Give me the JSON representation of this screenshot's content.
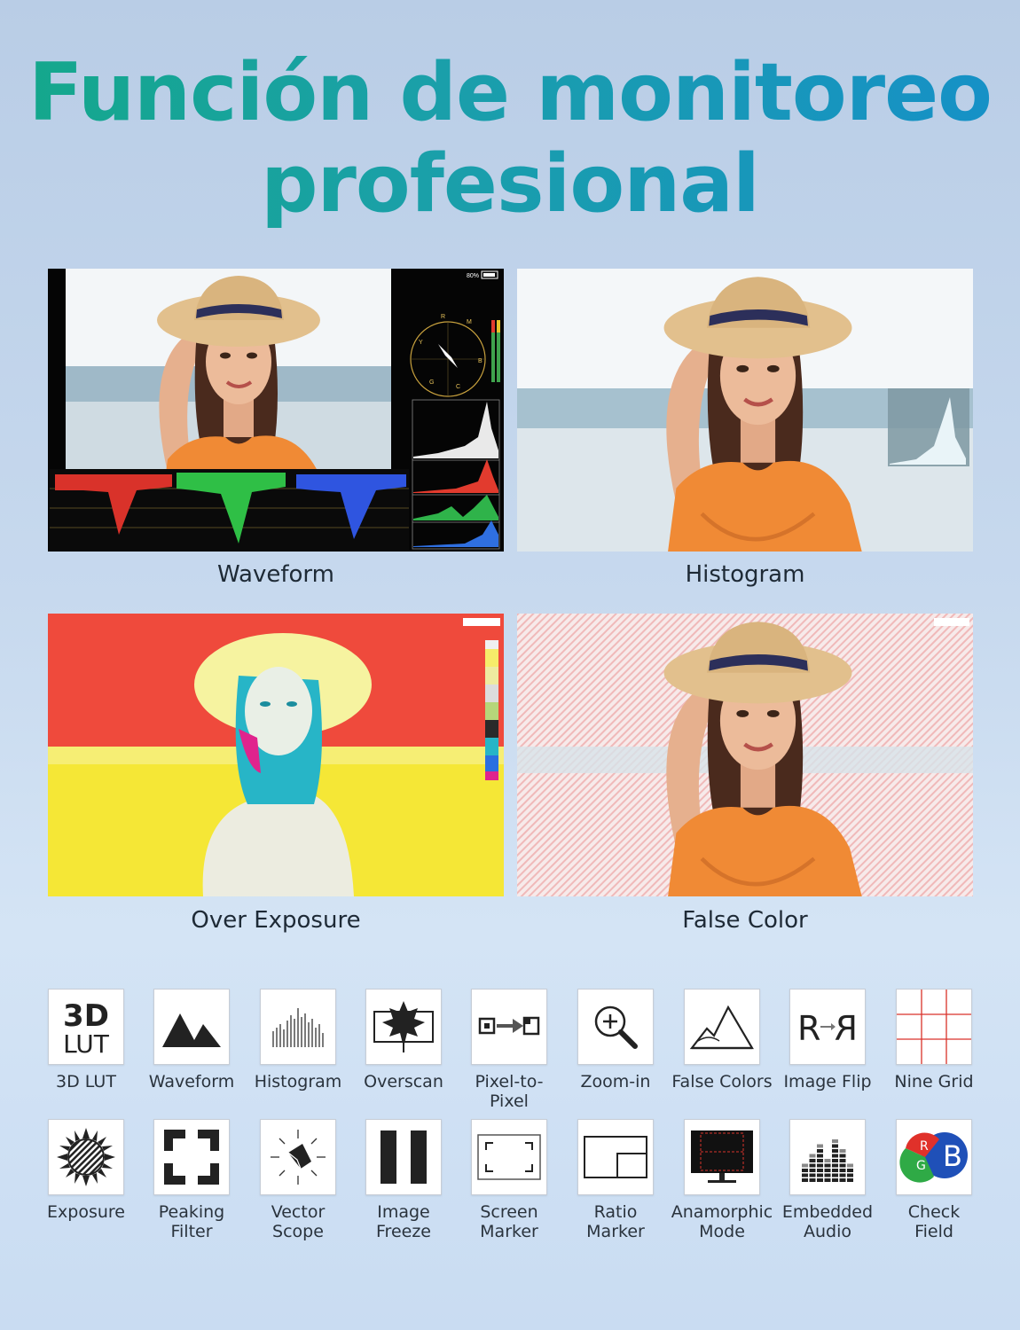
{
  "headline": {
    "line1": "Función de monitoreo",
    "line2": "profesional"
  },
  "panels": [
    {
      "id": "waveform",
      "caption": "Waveform",
      "battery": "80%",
      "vectorscope_letters": [
        "R",
        "M",
        "Y",
        "B",
        "G",
        "C"
      ]
    },
    {
      "id": "histogram",
      "caption": "Histogram"
    },
    {
      "id": "over-exposure",
      "caption": "Over Exposure"
    },
    {
      "id": "false-color",
      "caption": "False Color"
    }
  ],
  "features_row1": [
    {
      "icon": "3d-lut-icon",
      "icon_text": [
        "3D",
        "LUT"
      ],
      "label": "3D LUT"
    },
    {
      "icon": "mountain-waveform-icon",
      "label": "Waveform"
    },
    {
      "icon": "histogram-bars-icon",
      "label": "Histogram"
    },
    {
      "icon": "maple-leaf-icon",
      "label": "Overscan"
    },
    {
      "icon": "pixel-arrow-icon",
      "label": "Pixel-to-Pixel"
    },
    {
      "icon": "magnifier-plus-icon",
      "label": "Zoom-in"
    },
    {
      "icon": "mountain-outline-icon",
      "label": "False Colors"
    },
    {
      "icon": "flip-r-icon",
      "icon_text": [
        "R",
        "R"
      ],
      "label": "Image Flip"
    },
    {
      "icon": "nine-grid-icon",
      "label": "Nine Grid"
    }
  ],
  "features_row2": [
    {
      "icon": "sun-exposure-icon",
      "label": "Exposure"
    },
    {
      "icon": "focus-brackets-icon",
      "label": "Peaking\nFilter"
    },
    {
      "icon": "vector-scope-icon",
      "label": "Vector\nScope"
    },
    {
      "icon": "pause-bars-icon",
      "label": "Image\nFreeze"
    },
    {
      "icon": "screen-marker-icon",
      "label": "Screen\nMarker"
    },
    {
      "icon": "ratio-marker-icon",
      "label": "Ratio\nMarker"
    },
    {
      "icon": "monitor-anamorphic-icon",
      "label": "Anamorphic\nMode"
    },
    {
      "icon": "audio-meter-icon",
      "label": "Embedded\nAudio"
    },
    {
      "icon": "rgb-circles-icon",
      "icon_text": [
        "R",
        "G",
        "B"
      ],
      "label": "Check\nField"
    }
  ],
  "colors": {
    "title_gradient_start": "#14a88a",
    "title_gradient_end": "#1690c8",
    "over_exposure_red": "#ef4a3c",
    "over_exposure_yellow": "#f5e736",
    "false_color_stripe": "#f0b9b9",
    "dress_orange": "#f08a35",
    "hat_tan": "#e2c08d"
  }
}
